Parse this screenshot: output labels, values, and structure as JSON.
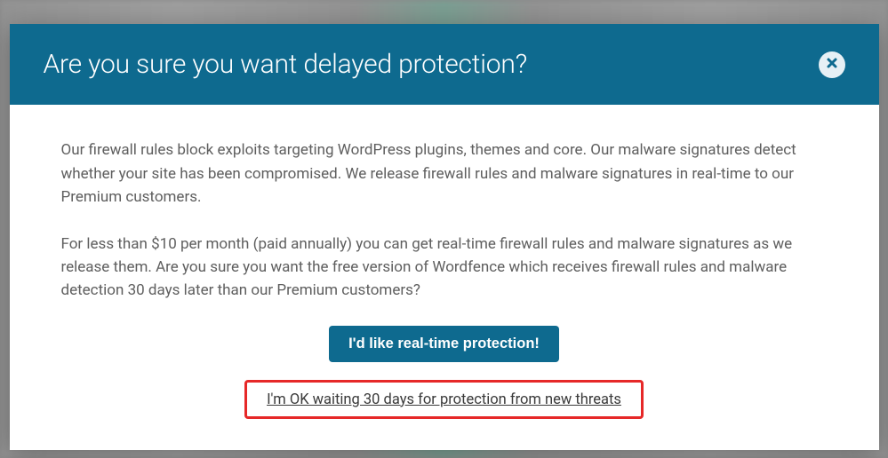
{
  "modal": {
    "title": "Are you sure you want delayed protection?",
    "paragraph1": "Our firewall rules block exploits targeting WordPress plugins, themes and core. Our malware signatures detect whether your site has been compromised. We release firewall rules and malware signatures in real-time to our Premium customers.",
    "paragraph2": "For less than $10 per month (paid annually) you can get real-time firewall rules and malware signatures as we release them. Are you sure you want the free version of Wordfence which receives firewall rules and malware detection 30 days later than our Premium customers?",
    "primary_button": "I'd like real-time protection!",
    "secondary_link": "I'm OK waiting 30 days for protection from new threats"
  }
}
